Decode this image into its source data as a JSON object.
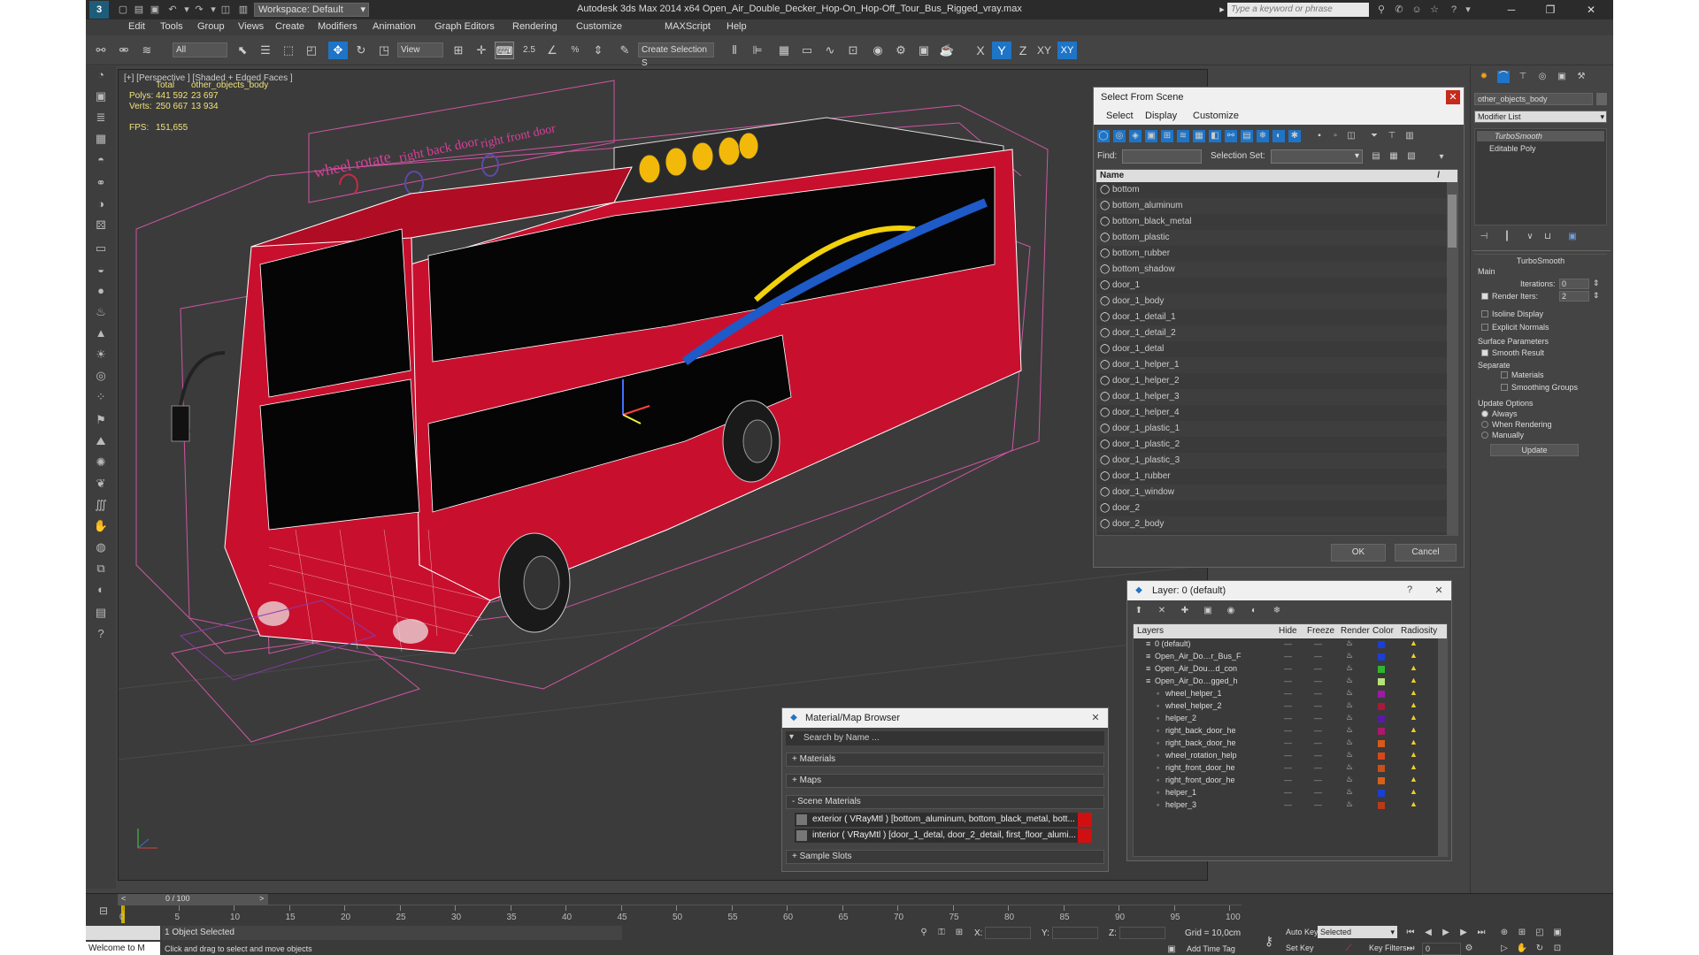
{
  "titlebar": {
    "logo": "3",
    "workspace": "Workspace: Default",
    "title": "Autodesk 3ds Max  2014 x64     Open_Air_Double_Decker_Hop-On_Hop-Off_Tour_Bus_Rigged_vray.max",
    "search_placeholder": "Type a keyword or phrase"
  },
  "menu": [
    "Edit",
    "Tools",
    "Group",
    "Views",
    "Create",
    "Modifiers",
    "Animation",
    "Graph Editors",
    "Rendering",
    "Customize",
    "MAXScript",
    "Help"
  ],
  "toolbar": {
    "filter_select": "All",
    "coord_select": "View",
    "selection_set_select": "Create Selection S"
  },
  "viewport": {
    "label": "[+] [Perspective ] [Shaded + Edged Faces ]",
    "stats": {
      "total_label": "Total",
      "object_label": "other_objects_body",
      "polys_label": "Polys:",
      "polys_total": "441 592",
      "polys_object": "23 697",
      "verts_label": "Verts:",
      "verts_total": "250 667",
      "verts_object": "13 934",
      "fps_label": "FPS:",
      "fps_value": "151,655"
    },
    "labels": [
      "wheel rotate",
      "right back door",
      "right front door"
    ]
  },
  "select_from_scene": {
    "title": "Select From Scene",
    "menu": [
      "Select",
      "Display",
      "Customize"
    ],
    "find_label": "Find:",
    "selection_set_label": "Selection Set:",
    "column_name": "Name",
    "items": [
      "bottom",
      "bottom_aluminum",
      "bottom_black_metal",
      "bottom_plastic",
      "bottom_rubber",
      "bottom_shadow",
      "door_1",
      "door_1_body",
      "door_1_detail_1",
      "door_1_detail_2",
      "door_1_detal",
      "door_1_helper_1",
      "door_1_helper_2",
      "door_1_helper_3",
      "door_1_helper_4",
      "door_1_plastic_1",
      "door_1_plastic_2",
      "door_1_plastic_3",
      "door_1_rubber",
      "door_1_window",
      "door_2",
      "door_2_body"
    ],
    "ok": "OK",
    "cancel": "Cancel"
  },
  "layer_dialog": {
    "title": "Layer: 0 (default)",
    "help": "?",
    "columns": [
      "Layers",
      "Hide",
      "Freeze",
      "Render",
      "Color",
      "Radiosity"
    ],
    "rows": [
      {
        "name": "0 (default)",
        "indent": 0,
        "color": "#1a3fd6"
      },
      {
        "name": "Open_Air_Do…r_Bus_F",
        "indent": 0,
        "color": "#1a3fd6"
      },
      {
        "name": "Open_Air_Dou…d_con",
        "indent": 0,
        "color": "#2fb52f"
      },
      {
        "name": "Open_Air_Do…gged_h",
        "indent": 0,
        "color": "#b8e07a"
      },
      {
        "name": "wheel_helper_1",
        "indent": 1,
        "color": "#9b1aa8"
      },
      {
        "name": "wheel_helper_2",
        "indent": 1,
        "color": "#a81a3a"
      },
      {
        "name": "helper_2",
        "indent": 1,
        "color": "#5a1aa8"
      },
      {
        "name": "right_back_door_he",
        "indent": 1,
        "color": "#a81a6a"
      },
      {
        "name": "right_back_door_he",
        "indent": 1,
        "color": "#d65a1a"
      },
      {
        "name": "wheel_rotation_help",
        "indent": 1,
        "color": "#d6481a"
      },
      {
        "name": "right_front_door_he",
        "indent": 1,
        "color": "#c8501a"
      },
      {
        "name": "right_front_door_he",
        "indent": 1,
        "color": "#d6601a"
      },
      {
        "name": "helper_1",
        "indent": 1,
        "color": "#1a3fd6"
      },
      {
        "name": "helper_3",
        "indent": 1,
        "color": "#b83a1a"
      }
    ]
  },
  "material_browser": {
    "title": "Material/Map Browser",
    "search_placeholder": "Search by Name ...",
    "sections": [
      "+ Materials",
      "+ Maps",
      "- Scene Materials"
    ],
    "materials": [
      "exterior  ( VRayMtl )  [bottom_aluminum, bottom_black_metal, bott...",
      "interior  ( VRayMtl )  [door_1_detal, door_2_detail, first_floor_alumi..."
    ],
    "sample_slots": "+ Sample Slots"
  },
  "command_panel": {
    "object_name": "other_objects_body",
    "modifier_list": "Modifier List",
    "stack": [
      "TurboSmooth",
      "Editable Poly"
    ],
    "rollout_title": "TurboSmooth",
    "main_label": "Main",
    "iterations_label": "Iterations:",
    "iterations_value": "0",
    "render_iters_label": "Render Iters:",
    "render_iters_value": "2",
    "isoline": "Isoline Display",
    "explicit": "Explicit Normals",
    "surface_params": "Surface Parameters",
    "smooth_result": "Smooth Result",
    "separate": "Separate",
    "materials": "Materials",
    "smoothing_groups": "Smoothing Groups",
    "update_options": "Update Options",
    "always": "Always",
    "when_rendering": "When Rendering",
    "manually": "Manually",
    "update_btn": "Update"
  },
  "timeline": {
    "frame_counter": "0 / 100",
    "ticks": [
      "0",
      "5",
      "10",
      "15",
      "20",
      "25",
      "30",
      "35",
      "40",
      "45",
      "50",
      "55",
      "60",
      "65",
      "70",
      "75",
      "80",
      "85",
      "90",
      "95",
      "100"
    ],
    "status_selected": "1 Object Selected",
    "status_hint": "Click and drag to select and move objects",
    "welcome": "Welcome to M",
    "x_label": "X:",
    "y_label": "Y:",
    "z_label": "Z:",
    "grid": "Grid = 10,0cm",
    "add_time_tag": "Add Time Tag",
    "auto_key": "Auto Key",
    "set_key": "Set Key",
    "selected_select": "Selected",
    "key_filters": "Key Filters...",
    "frame_value": "0"
  }
}
